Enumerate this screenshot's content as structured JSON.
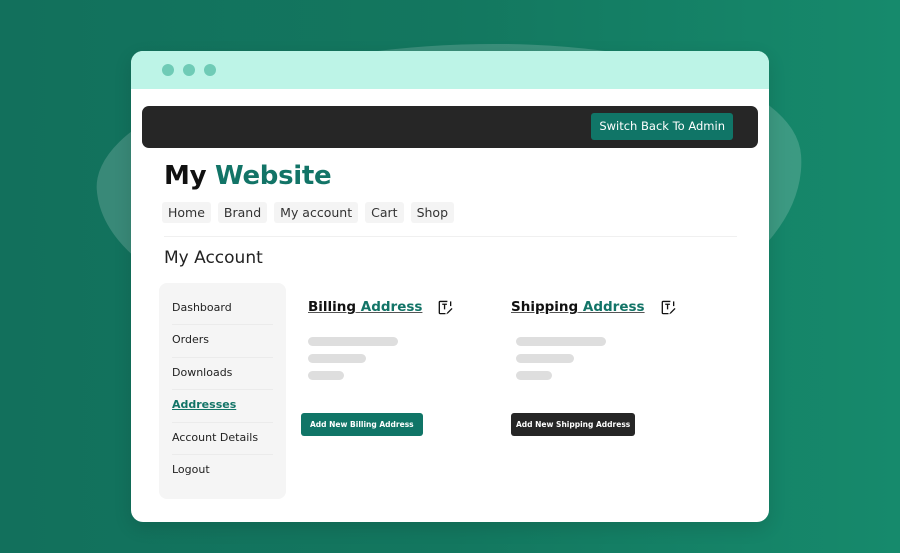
{
  "window": {
    "title_dots": 3
  },
  "admin_bar": {
    "switch_button": "Switch Back To Admin"
  },
  "site": {
    "title_part1": "My",
    "title_part2": "Website"
  },
  "nav": {
    "items": [
      "Home",
      "Brand",
      "My account",
      "Cart",
      "Shop"
    ]
  },
  "page": {
    "heading": "My Account"
  },
  "sidebar": {
    "items": [
      {
        "label": "Dashboard",
        "active": false
      },
      {
        "label": "Orders",
        "active": false
      },
      {
        "label": "Downloads",
        "active": false
      },
      {
        "label": "Addresses",
        "active": true
      },
      {
        "label": "Account Details",
        "active": false
      },
      {
        "label": "Logout",
        "active": false
      }
    ]
  },
  "billing": {
    "title_part1": "Billing",
    "title_part2": "Address",
    "edit_icon": "edit-icon",
    "add_button": "Add New Billing Address"
  },
  "shipping": {
    "title_part1": "Shipping",
    "title_part2": "Address",
    "edit_icon": "edit-icon",
    "add_button": "Add New Shipping Address"
  },
  "colors": {
    "brand": "#127467",
    "background": "#13775f",
    "titlebar": "#bdf4e7",
    "admin_bar": "#262626",
    "dark_button": "#262626"
  }
}
